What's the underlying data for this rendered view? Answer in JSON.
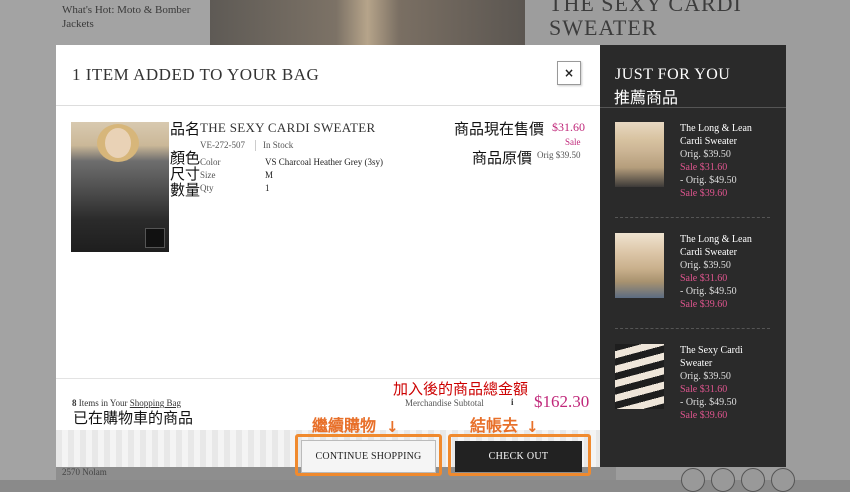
{
  "background": {
    "left_text": "What's Hot: Moto & Bomber Jackets",
    "right_heading": "THE SEXY CARDI SWEATER"
  },
  "modal": {
    "title": "1 ITEM ADDED TO YOUR BAG",
    "close_label": "×",
    "item": {
      "zh_name_label": "品名",
      "name": "THE SEXY CARDI SWEATER",
      "sku": "VE-272-507",
      "stock": "In Stock",
      "zh_color": "顏色",
      "zh_size": "尺寸",
      "zh_qty": "數量",
      "color_label": "Color",
      "color_value": "VS Charcoal Heather Grey (3sy)",
      "size_label": "Size",
      "size_value": "M",
      "qty_label": "Qty",
      "qty_value": "1",
      "zh_price_now": "商品現在售價",
      "price_now": "$31.60",
      "sale_label": "Sale",
      "zh_price_orig": "商品原價",
      "price_orig": "Orig $39.50"
    },
    "bag": {
      "count": "8",
      "text": " Items in Your ",
      "link": "Shopping Bag",
      "zh": "已在購物車的商品"
    },
    "subtotal": {
      "zh": "加入後的商品總金額",
      "label": "Merchandise Subtotal",
      "info": "i",
      "value": "$162.30"
    },
    "buttons": {
      "zh_continue": "繼續購物",
      "zh_checkout": "結帳去",
      "continue": "CONTINUE SHOPPING",
      "checkout": "CHECK OUT"
    }
  },
  "panel": {
    "title": "JUST FOR YOU",
    "zh": "推薦商品",
    "items": [
      {
        "name": "The Long & Lean Cardi Sweater",
        "orig1": "Orig. $39.50",
        "sale1": "Sale $31.60",
        "orig2": "- Orig. $49.50",
        "sale2": "Sale $39.60"
      },
      {
        "name": "The Long & Lean Cardi Sweater",
        "orig1": "Orig. $39.50",
        "sale1": "Sale $31.60",
        "orig2": "- Orig. $49.50",
        "sale2": "Sale $39.60"
      },
      {
        "name": "The Sexy Cardi Sweater",
        "orig1": "Orig. $39.50",
        "sale1": "Sale $31.60",
        "orig2": "- Orig. $49.50",
        "sale2": "Sale $39.60"
      }
    ]
  },
  "footer_text": "2570 Nolam",
  "colors": {
    "sale_pink": "#c0287a",
    "annotation_orange": "#e8702a",
    "annotation_red": "#cc0000",
    "panel_dark": "#2a2a2a"
  }
}
